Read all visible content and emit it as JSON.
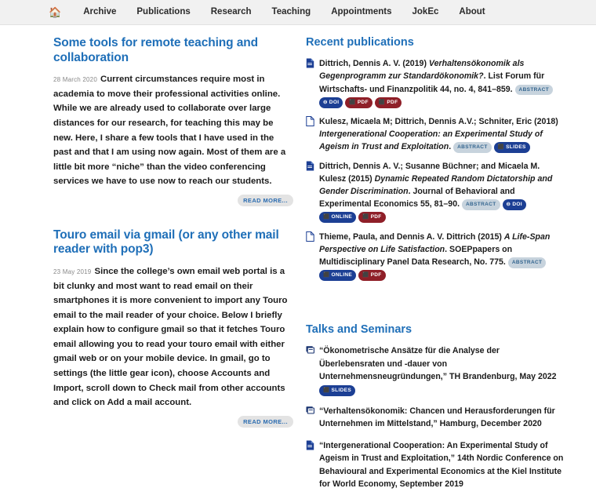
{
  "nav": {
    "home_icon": "home-icon",
    "items": [
      {
        "label": "Archive"
      },
      {
        "label": "Publications"
      },
      {
        "label": "Research"
      },
      {
        "label": "Teaching"
      },
      {
        "label": "Appointments"
      },
      {
        "label": "JokEc"
      },
      {
        "label": "About"
      }
    ]
  },
  "posts": [
    {
      "title": "Some tools for remote teaching and collaboration",
      "date": "28 March 2020",
      "body": "Current circumstances require most in academia to move their professional activities online. While we are already used to collaborate over large distances for our research, for teaching this may be new. Here, I share a few tools that I have used in the past and that I am using now again. Most of them are a little bit more “niche” than the video conferencing services we have to use now to reach our students.",
      "read_more": "READ MORE..."
    },
    {
      "title": "Touro email via gmail (or any other mail reader with pop3)",
      "date": "23 May 2019",
      "body": "Since the college’s own email web portal is a bit clunky and most want to read email on their smartphones it is more convenient to import any Touro email to the mail reader of your choice. Below I briefly explain how to configure gmail so that it fetches Touro email allowing you to read your touro email with either gmail web or on your mobile device. In gmail, go to settings (the little gear icon), choose Accounts and Import, scroll down to Check mail from other accounts and click on Add a mail account.",
      "read_more": "READ MORE..."
    }
  ],
  "publications": {
    "heading": "Recent publications",
    "items": [
      {
        "icon": "file-filled-icon",
        "authors": "Dittrich, Dennis A. V. (2019) ",
        "title_italic": "Verhaltensökonomik als Gegenprogramm zur Standardökonomik?",
        "venue": ". List Forum für Wirtschafts- und Finanzpolitik ",
        "volume": "44",
        "tail": ", no. 4, 841–859.",
        "badges": [
          {
            "label": "ABSTRACT",
            "kind": "abstract"
          },
          {
            "label": "DOI",
            "kind": "doi"
          },
          {
            "label": "PDF",
            "kind": "pdf"
          },
          {
            "label": "PDF",
            "kind": "pdf"
          }
        ]
      },
      {
        "icon": "file-outline-icon",
        "authors": "Kulesz, Micaela M; Dittrich, Dennis A.V.; Schniter, Eric (2018) ",
        "title_italic": "Intergenerational Cooperation: an Experimental Study of Ageism in Trust and Exploitation",
        "venue": ".",
        "volume": "",
        "tail": "",
        "badges": [
          {
            "label": "ABSTRACT",
            "kind": "abstract"
          },
          {
            "label": "SLIDES",
            "kind": "slides"
          }
        ]
      },
      {
        "icon": "file-filled-icon",
        "authors": "Dittrich, Dennis A. V.; Susanne Büchner; and Micaela M. Kulesz (2015) ",
        "title_italic": "Dynamic Repeated Random Dictatorship and Gender Discrimination",
        "venue": ". Journal of Behavioral and Experimental Economics ",
        "volume": "55",
        "tail": ", 81–90.",
        "badges": [
          {
            "label": "ABSTRACT",
            "kind": "abstract"
          },
          {
            "label": "DOI",
            "kind": "doi"
          },
          {
            "label": "ONLINE",
            "kind": "online"
          },
          {
            "label": "PDF",
            "kind": "pdf"
          }
        ]
      },
      {
        "icon": "file-outline-icon",
        "authors": "Thieme, Paula, and Dennis A. V. Dittrich (2015) ",
        "title_italic": "A Life-Span Perspective on Life Satisfaction",
        "venue": ". SOEPpapers on Multidisciplinary Panel Data Research, No. 775.",
        "volume": "",
        "tail": "",
        "badges": [
          {
            "label": "ABSTRACT",
            "kind": "abstract"
          },
          {
            "label": "ONLINE",
            "kind": "online"
          },
          {
            "label": "PDF",
            "kind": "pdf"
          }
        ]
      }
    ]
  },
  "talks": {
    "heading": "Talks and Seminars",
    "items": [
      {
        "icon": "presentation-icon",
        "text": "“Ökonometrische Ansätze für die Analyse der Überlebensraten und -dauer von Unternehmensneugründungen,” TH Brandenburg, May 2022",
        "badges": [
          {
            "label": "SLIDES",
            "kind": "slides"
          }
        ]
      },
      {
        "icon": "presentation-icon",
        "text": "“Verhaltensökonomik: Chancen und Herausforderungen für Unternehmen im Mittelstand,” Hamburg, December 2020",
        "badges": []
      },
      {
        "icon": "file-filled-icon",
        "text": "“Intergenerational Cooperation: An Experimental Study of Ageism in Trust and Exploitation,” 14th Nordic Conference on Behavioural and Experimental Economics at the Kiel Institute for World Economy, September 2019",
        "badges": []
      }
    ]
  },
  "colors": {
    "accent_blue": "#1f6fb8",
    "nav_bg": "#f1f1f1",
    "badge_doi": "#1c3f94",
    "badge_pdf": "#8f1f28",
    "badge_abstract": "#c7d3dd"
  }
}
